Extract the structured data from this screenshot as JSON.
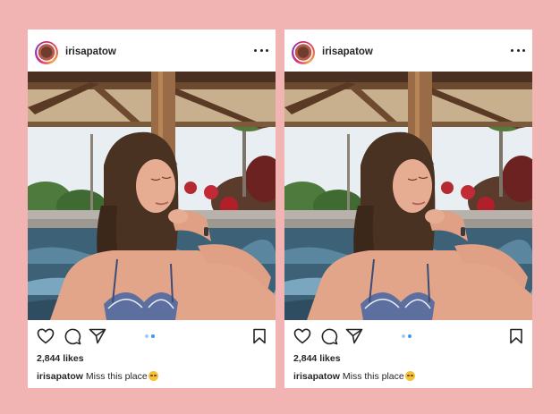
{
  "posts": [
    {
      "username": "irisapatow",
      "likes": "2,844 likes",
      "caption_user": "irisapatow",
      "caption_text": "Miss this place",
      "caption_emoji": "smirking-face-emoji",
      "carousel_active_index": 2,
      "carousel_count": 2
    },
    {
      "username": "irisapatow",
      "likes": "2,844 likes",
      "caption_user": "irisapatow",
      "caption_text": "Miss this place",
      "caption_emoji": "smirking-face-emoji",
      "carousel_active_index": 2,
      "carousel_count": 2
    }
  ],
  "icons": {
    "more": "more-options-icon",
    "like": "heart-icon",
    "comment": "comment-icon",
    "share": "share-icon",
    "save": "bookmark-icon"
  },
  "colors": {
    "background": "#f2b3b3",
    "card": "#ffffff",
    "text": "#262626",
    "dot_active": "#3897f0",
    "dot_inactive": "#a9c8ef"
  }
}
